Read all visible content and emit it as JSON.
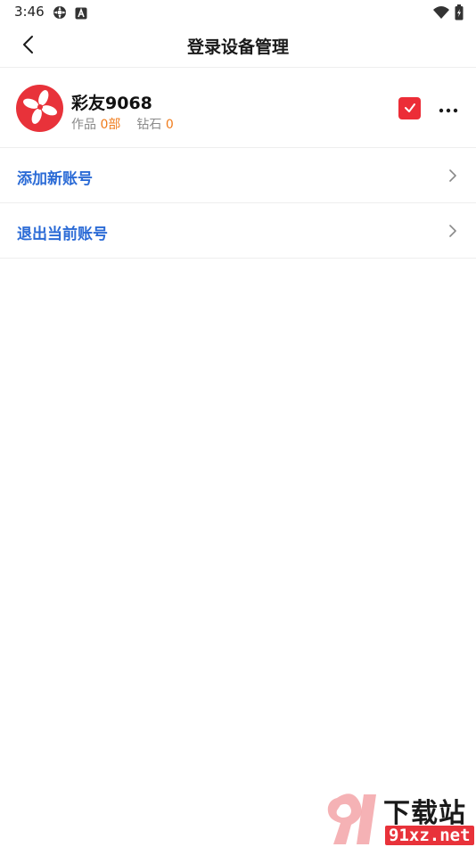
{
  "status_bar": {
    "time": "3:46",
    "left_icons": [
      "gear-status-icon",
      "text-a-icon"
    ],
    "right_icons": [
      "wifi-icon",
      "battery-icon"
    ]
  },
  "header": {
    "title": "登录设备管理",
    "back_icon": "chevron-left-icon"
  },
  "account": {
    "name": "彩友9068",
    "works_label": "作品",
    "works_value": "0部",
    "diamonds_label": "钻石",
    "diamonds_value": "0",
    "selected": true,
    "avatar_color": "#e8323a",
    "accent_color": "#f07c1c"
  },
  "menu": {
    "items": [
      {
        "label": "添加新账号"
      },
      {
        "label": "退出当前账号"
      }
    ],
    "link_color": "#2b6bd6"
  },
  "watermark": {
    "title": "下载站",
    "domain": "91xz.net"
  }
}
